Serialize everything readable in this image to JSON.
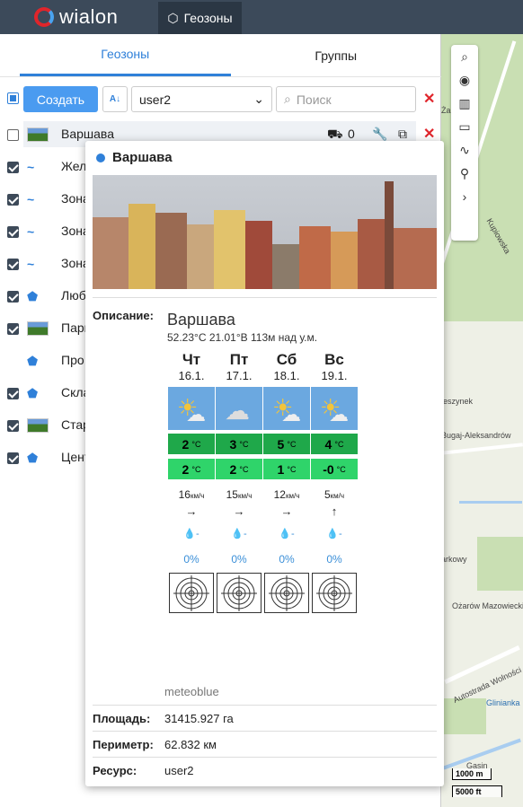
{
  "app": {
    "brand": "wialon",
    "nav_tab": "Геозоны"
  },
  "tabs": [
    "Геозоны",
    "Группы"
  ],
  "toolbar": {
    "create_label": "Создать",
    "sort_label": "A↓",
    "resource_value": "user2",
    "search_placeholder": "Поиск"
  },
  "rows": [
    {
      "name": "Варшава",
      "checked": false,
      "icon": "thumb-icon",
      "units": "0"
    },
    {
      "name": "Жел",
      "checked": true,
      "icon": "line-icon"
    },
    {
      "name": "Зона",
      "checked": true,
      "icon": "line-icon"
    },
    {
      "name": "Зона",
      "checked": true,
      "icon": "line-icon"
    },
    {
      "name": "Зона",
      "checked": true,
      "icon": "line-icon"
    },
    {
      "name": "Люб",
      "checked": true,
      "icon": "polygon-icon"
    },
    {
      "name": "Парк",
      "checked": true,
      "icon": "thumb-icon"
    },
    {
      "name": "Про",
      "checked": false,
      "icon": "polygon-icon"
    },
    {
      "name": "Скла",
      "checked": true,
      "icon": "polygon-icon"
    },
    {
      "name": "Стар",
      "checked": true,
      "icon": "thumb-icon"
    },
    {
      "name": "Цент",
      "checked": true,
      "icon": "polygon-icon"
    }
  ],
  "popup": {
    "title": "Варшава",
    "description_label": "Описание:",
    "city": "Варшава",
    "coords": "52.23°С 21.01°В 113м над у.м.",
    "days": [
      {
        "name": "Чт",
        "date": "16.1.",
        "hi": "2",
        "lo": "2",
        "wind": "16",
        "arrow": "→",
        "prec": "-",
        "pct": "0%",
        "icon": "partly-cloudy-icon"
      },
      {
        "name": "Пт",
        "date": "17.1.",
        "hi": "3",
        "lo": "2",
        "wind": "15",
        "arrow": "→",
        "prec": "-",
        "pct": "0%",
        "icon": "cloudy-icon"
      },
      {
        "name": "Сб",
        "date": "18.1.",
        "hi": "5",
        "lo": "1",
        "wind": "12",
        "arrow": "→",
        "prec": "-",
        "pct": "0%",
        "icon": "partly-cloudy-icon"
      },
      {
        "name": "Вс",
        "date": "19.1.",
        "hi": "4",
        "lo": "-0",
        "wind": "5",
        "arrow": "↑",
        "prec": "-",
        "pct": "0%",
        "icon": "partly-cloudy-icon"
      }
    ],
    "temp_unit": "°C",
    "wind_unit": "км/ч",
    "source": "meteoblue",
    "area_label": "Площадь:",
    "area_value": "31415.927 га",
    "perimeter_label": "Периметр:",
    "perimeter_value": "62.832 км",
    "resource_label": "Ресурс:",
    "resource_value": "user2"
  },
  "map": {
    "labels": [
      "Bugaj-Aleksandrów",
      "eszynek",
      "Ożarów Mazowiecki",
      "Autostrada Wolności",
      "Glinianka",
      "Gasin",
      "Kupiowska",
      "Ża",
      "arkowy"
    ],
    "scale_km": "1000 m",
    "scale_ft": "5000 ft"
  }
}
